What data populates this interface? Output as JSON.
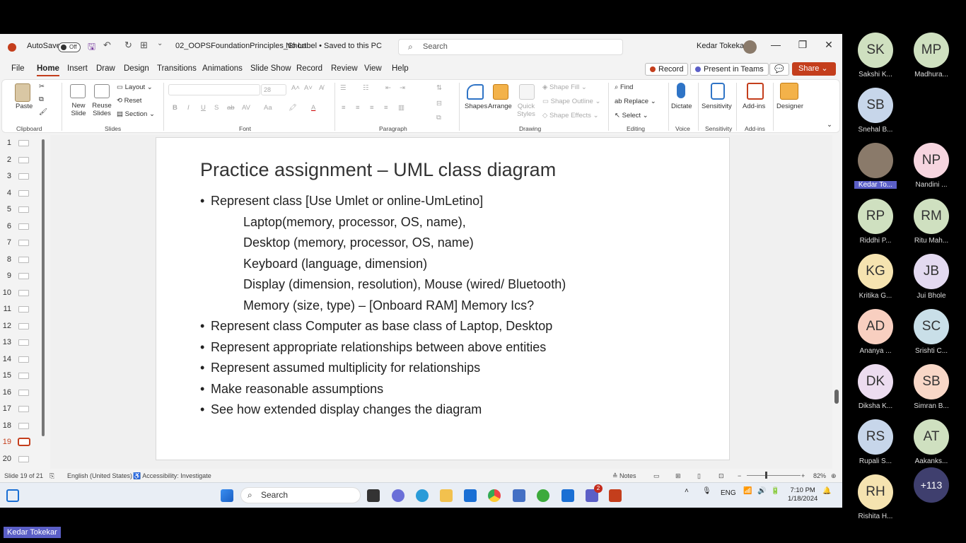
{
  "window": {
    "autosave_label": "AutoSave",
    "autosave_state": "Off",
    "doc_name": "02_OOPSFoundationPrinciples_Short",
    "label_info": "No Label • Saved to this PC",
    "search_placeholder": "Search",
    "user_name": "Kedar Tokekar"
  },
  "menu": {
    "tabs": [
      "File",
      "Home",
      "Insert",
      "Draw",
      "Design",
      "Transitions",
      "Animations",
      "Slide Show",
      "Record",
      "Review",
      "View",
      "Help"
    ],
    "record_btn": "Record",
    "present_btn": "Present in Teams",
    "share_btn": "Share"
  },
  "ribbon": {
    "paste": "Paste",
    "clipboard": "Clipboard",
    "new_slide": "New Slide",
    "reuse_slides": "Reuse Slides",
    "layout": "Layout",
    "reset": "Reset",
    "section": "Section",
    "slides": "Slides",
    "font_group": "Font",
    "font_size": "28",
    "paragraph": "Paragraph",
    "shapes": "Shapes",
    "arrange": "Arrange",
    "quick_styles": "Quick Styles",
    "shape_fill": "Shape Fill",
    "shape_outline": "Shape Outline",
    "shape_effects": "Shape Effects",
    "drawing": "Drawing",
    "find": "Find",
    "replace": "Replace",
    "select": "Select",
    "editing": "Editing",
    "dictate": "Dictate",
    "voice": "Voice",
    "sensitivity_btn": "Sensitivity",
    "sensitivity_grp": "Sensitivity",
    "addins_btn": "Add-ins",
    "addins_grp": "Add-ins",
    "designer": "Designer"
  },
  "thumbnails": {
    "numbers": [
      "1",
      "2",
      "3",
      "4",
      "5",
      "6",
      "7",
      "8",
      "9",
      "10",
      "11",
      "12",
      "13",
      "14",
      "15",
      "16",
      "17",
      "18",
      "19",
      "20"
    ],
    "active_index": 18
  },
  "slide": {
    "title": "Practice assignment – UML class diagram",
    "lines": [
      {
        "kind": "bullet",
        "text": "Represent class [Use Umlet or online-UmLetino]"
      },
      {
        "kind": "sub",
        "text": "Laptop(memory, processor, OS, name),"
      },
      {
        "kind": "sub",
        "text": "Desktop (memory, processor, OS, name)"
      },
      {
        "kind": "sub",
        "text": "Keyboard (language, dimension)"
      },
      {
        "kind": "sub",
        "text": "Display (dimension, resolution), Mouse (wired/ Bluetooth)"
      },
      {
        "kind": "sub",
        "text": "Memory (size, type) – [Onboard RAM] Memory Ics?"
      },
      {
        "kind": "bullet",
        "text": "Represent class Computer as base class of Laptop, Desktop"
      },
      {
        "kind": "bullet",
        "text": "Represent appropriate relationships between above entities"
      },
      {
        "kind": "bullet",
        "text": "Represent assumed multiplicity for relationships"
      },
      {
        "kind": "bullet",
        "text": "Make reasonable assumptions"
      },
      {
        "kind": "bullet",
        "text": "See how extended display changes the diagram"
      }
    ]
  },
  "status": {
    "slide_info": "Slide 19 of 21",
    "language": "English (United States)",
    "accessibility": "Accessibility: Investigate",
    "notes": "Notes",
    "zoom": "82%"
  },
  "taskbar": {
    "search": "Search",
    "lang": "ENG",
    "time": "7:10 PM",
    "date": "1/18/2024",
    "teams_badge": "2"
  },
  "participants": [
    {
      "initials": "SK",
      "name": "Sakshi K...",
      "color": "#cfe0c0"
    },
    {
      "initials": "MP",
      "name": "Madhura...",
      "color": "#cfe0c0"
    },
    {
      "initials": "SB",
      "name": "Snehal B...",
      "color": "#c7d6ea"
    },
    {
      "initials": "",
      "name": "Kedar To...",
      "color": "#8a7a6a",
      "photo": true,
      "highlight": true
    },
    {
      "initials": "NP",
      "name": "Nandini ...",
      "color": "#f6d5df"
    },
    {
      "initials": "RP",
      "name": "Riddhi P...",
      "color": "#cfe0c0"
    },
    {
      "initials": "RM",
      "name": "Ritu Mah...",
      "color": "#cfe0c0"
    },
    {
      "initials": "KG",
      "name": "Kritika G...",
      "color": "#f5e3b0"
    },
    {
      "initials": "JB",
      "name": "Jui Bhole",
      "color": "#e3d9f0"
    },
    {
      "initials": "AD",
      "name": "Ananya ...",
      "color": "#f8cfc0"
    },
    {
      "initials": "SC",
      "name": "Srishti  C...",
      "color": "#c9dfe8"
    },
    {
      "initials": "DK",
      "name": "Diksha K...",
      "color": "#ecdcef"
    },
    {
      "initials": "SB",
      "name": "Simran B...",
      "color": "#f8d7c7"
    },
    {
      "initials": "RS",
      "name": "Rupali S...",
      "color": "#c7d6ea"
    },
    {
      "initials": "AT",
      "name": "Aakanks...",
      "color": "#cfe0c0"
    },
    {
      "initials": "RH",
      "name": "Rishita H...",
      "color": "#f5e3b0"
    },
    {
      "initials": "+113",
      "name": "",
      "color": "#3f3f6e"
    }
  ],
  "presenter_label": "Kedar Tokekar"
}
